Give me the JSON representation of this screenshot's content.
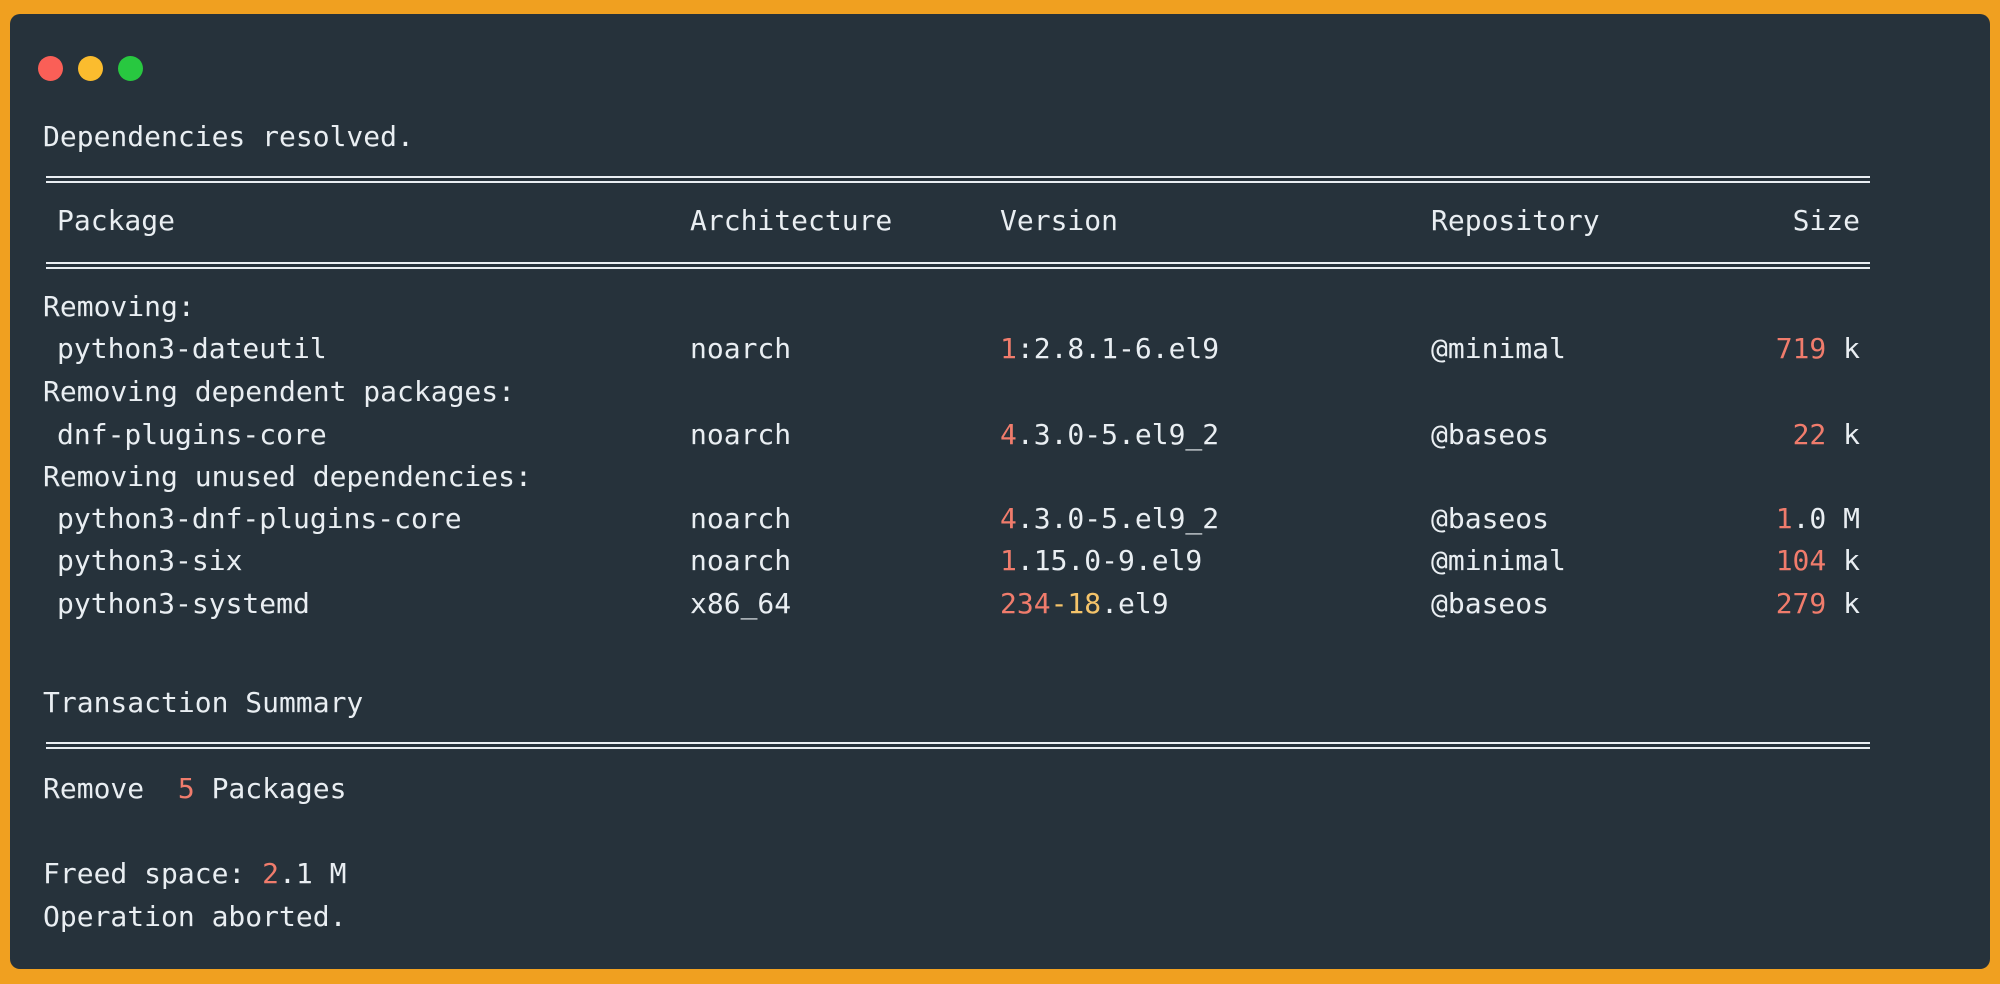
{
  "window": {
    "controls": [
      "close",
      "minimize",
      "maximize"
    ],
    "colors": {
      "background": "#26323b",
      "border": "#f0a020",
      "text": "#e9eef2",
      "number": "#f07c6c",
      "number_alt": "#f5c46a"
    }
  },
  "output": {
    "deps_resolved": "Dependencies resolved.",
    "headers": {
      "package": "Package",
      "architecture": "Architecture",
      "version": "Version",
      "repository": "Repository",
      "size": "Size"
    },
    "sections": {
      "removing": "Removing:",
      "removing_dependent": "Removing dependent packages:",
      "removing_unused": "Removing unused dependencies:"
    },
    "rows": [
      {
        "package": "python3-dateutil",
        "arch": "noarch",
        "ver_a": "1",
        "ver_b": "",
        "ver_c": ":2.8.1-6.el9",
        "repo": "@minimal",
        "size_num": "719",
        "size_rest": "",
        "size_unit": " k"
      },
      {
        "package": "dnf-plugins-core",
        "arch": "noarch",
        "ver_a": "4",
        "ver_b": "",
        "ver_c": ".3.0-5.el9_2",
        "repo": "@baseos",
        "size_num": "22",
        "size_rest": "",
        "size_unit": " k"
      },
      {
        "package": "python3-dnf-plugins-core",
        "arch": "noarch",
        "ver_a": "4",
        "ver_b": "",
        "ver_c": ".3.0-5.el9_2",
        "repo": "@baseos",
        "size_num": "1",
        "size_rest": ".0",
        "size_unit": " M"
      },
      {
        "package": "python3-six",
        "arch": "noarch",
        "ver_a": "1",
        "ver_b": "",
        "ver_c": ".15.0-9.el9",
        "repo": "@minimal",
        "size_num": "104",
        "size_rest": "",
        "size_unit": " k"
      },
      {
        "package": "python3-systemd",
        "arch": "x86_64",
        "ver_a": "234",
        "ver_b": "-18",
        "ver_c": ".el9",
        "repo": "@baseos",
        "size_num": "279",
        "size_rest": "",
        "size_unit": " k"
      }
    ],
    "summary_title": "Transaction Summary",
    "remove_label": "Remove  ",
    "remove_count": "5",
    "remove_suffix": " Packages",
    "freed_label": "Freed space: ",
    "freed_num": "2",
    "freed_rest": ".1 M",
    "aborted": "Operation aborted."
  }
}
